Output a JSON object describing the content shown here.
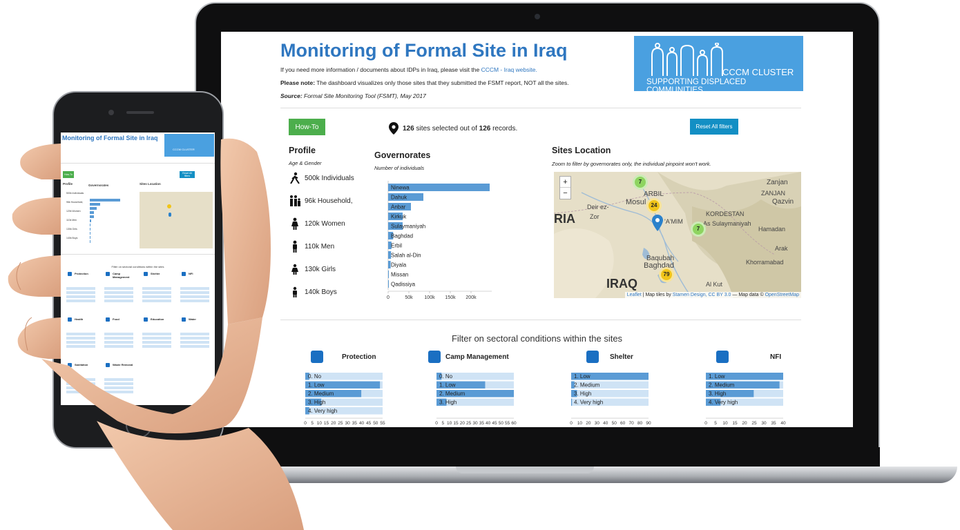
{
  "dashboard": {
    "title": "Monitoring of Formal Site in Iraq",
    "intro_prefix": "If you need more information / documents about IDPs in Iraq, please visit the ",
    "intro_link": "CCCM - Iraq website.",
    "note_label": "Please note:",
    "note_text": " The dashboard visualizes only those sites that they submitted the FSMT report, NOT all the sites.",
    "source_label": "Source:",
    "source_text": " Formal Site Monitoring Tool (FSMT), May 2017",
    "logo": {
      "line1": "CCCM CLUSTER",
      "line2": "SUPPORTING DISPLACED COMMUNITIES"
    },
    "howto_label": "How-To",
    "selected_count": "126",
    "selected_mid": " sites selected out of ",
    "selected_total": "126",
    "selected_suffix": " records.",
    "reset_label": "Reset All filters",
    "profile": {
      "title": "Profile",
      "subtitle": "Age & Gender",
      "rows": [
        "500k Individuals",
        "96k Household,",
        "120k Women",
        "110k Men",
        "130k Girls",
        "140k Boys"
      ]
    },
    "governorates": {
      "title": "Governorates",
      "subtitle": "Number of individuals"
    },
    "map": {
      "title": "Sites Location",
      "subtitle": "Zoom to filter by governorates only, the individual pinpoint won't work.",
      "zoom_in": "+",
      "zoom_out": "−",
      "labels": [
        "Zanjan",
        "ZANJAN",
        "Qazvin",
        "ARBIL",
        "Deir ez-",
        "Zor",
        "Mosul",
        "KORDESTAN",
        "As Sulaymaniyah",
        "Hamadan",
        "Arak",
        "RIA",
        "'A'MIM",
        "Baqubah",
        "Baghdad",
        "Khorramabad",
        "IRAQ",
        "Al Kut"
      ],
      "clusters": [
        "7",
        "24",
        "7",
        "79"
      ],
      "attribution_leaflet": "Leaflet",
      "attribution_mid": " | Map tiles by ",
      "attribution_stamen": "Stamen Design, CC BY 3.0",
      "attribution_dash": " — Map data © ",
      "attribution_osm": "OpenStreetMap"
    },
    "filter_title": "Filter on sectoral conditions within the sites",
    "sectors": [
      {
        "name": "Protection",
        "rows": [
          "0. No",
          "1. Low",
          "2. Medium",
          "3. High",
          "4. Very high"
        ],
        "ticks": [
          "0",
          "5",
          "10",
          "15",
          "20",
          "25",
          "30",
          "35",
          "40",
          "45",
          "50",
          "55"
        ]
      },
      {
        "name": "Camp Management",
        "rows": [
          "0. No",
          "1. Low",
          "2. Medium",
          "3. High"
        ],
        "ticks": [
          "0",
          "5",
          "10",
          "15",
          "20",
          "25",
          "30",
          "35",
          "40",
          "45",
          "50",
          "55",
          "60"
        ]
      },
      {
        "name": "Shelter",
        "rows": [
          "1. Low",
          "2. Medium",
          "3. High",
          "4. Very high"
        ],
        "ticks": [
          "0",
          "10",
          "20",
          "30",
          "40",
          "50",
          "60",
          "70",
          "80",
          "90"
        ]
      },
      {
        "name": "NFI",
        "rows": [
          "1. Low",
          "2. Medium",
          "3. High",
          "4. Very high"
        ],
        "ticks": [
          "0",
          "5",
          "10",
          "15",
          "20",
          "25",
          "30",
          "35",
          "40"
        ]
      }
    ]
  },
  "phone": {
    "title": "Monitoring of Formal Site in Iraq",
    "logo_text": "CCCM CLUSTER",
    "howto": "How-To",
    "reset": "Reset All filters",
    "profile": "Profile",
    "governorates": "Governorates",
    "sites_location": "Sites Location",
    "filter_title": "Filter on sectoral conditions within the sites",
    "sectors": [
      "Protection",
      "Camp Management",
      "Shelter",
      "NFI",
      "Health",
      "Food",
      "Education",
      "Water",
      "Sanitation",
      "Waste Removal"
    ],
    "profile_rows": [
      "500k Individuals",
      "96k Household,",
      "120k Women",
      "110k Men",
      "130k Girls",
      "140k Boys"
    ]
  },
  "colors": {
    "accent": "#2f77c0",
    "bar": "#5a9bd5",
    "bar_light": "#cfe3f5",
    "howto": "#4cae4c",
    "reset": "#138fc4",
    "logo": "#4aa0e0"
  },
  "chart_data": [
    {
      "type": "bar",
      "title": "Governorates",
      "subtitle": "Number of individuals",
      "orientation": "horizontal",
      "categories": [
        "Ninewa",
        "Dahuk",
        "Anbar",
        "Kirkuk",
        "Sulaymaniyah",
        "Baghdad",
        "Erbil",
        "Salah al-Din",
        "Diyala",
        "Missan",
        "Qadissiya"
      ],
      "values": [
        245000,
        85000,
        55000,
        35000,
        35000,
        12000,
        8000,
        7000,
        6000,
        1000,
        500
      ],
      "xticks": [
        "0",
        "50k",
        "100k",
        "150k",
        "200k"
      ],
      "xlim": [
        0,
        250000
      ]
    },
    {
      "type": "bar",
      "title": "Protection",
      "orientation": "horizontal",
      "categories": [
        "0. No",
        "1. Low",
        "2. Medium",
        "3. High",
        "4. Very high"
      ],
      "values": [
        3,
        56,
        42,
        12,
        3
      ],
      "xlim": [
        0,
        58
      ]
    },
    {
      "type": "bar",
      "title": "Camp Management",
      "orientation": "horizontal",
      "categories": [
        "0. No",
        "1. Low",
        "2. Medium",
        "3. High"
      ],
      "values": [
        4,
        39,
        62,
        8
      ],
      "xlim": [
        0,
        62
      ]
    },
    {
      "type": "bar",
      "title": "Shelter",
      "orientation": "horizontal",
      "categories": [
        "1. Low",
        "2. Medium",
        "3. High",
        "4. Very high"
      ],
      "values": [
        93,
        4,
        7,
        1
      ],
      "xlim": [
        0,
        93
      ]
    },
    {
      "type": "bar",
      "title": "NFI",
      "orientation": "horizontal",
      "categories": [
        "1. Low",
        "2. Medium",
        "3. High",
        "4. Very high"
      ],
      "values": [
        42,
        40,
        26,
        8
      ],
      "xlim": [
        0,
        42
      ]
    }
  ]
}
